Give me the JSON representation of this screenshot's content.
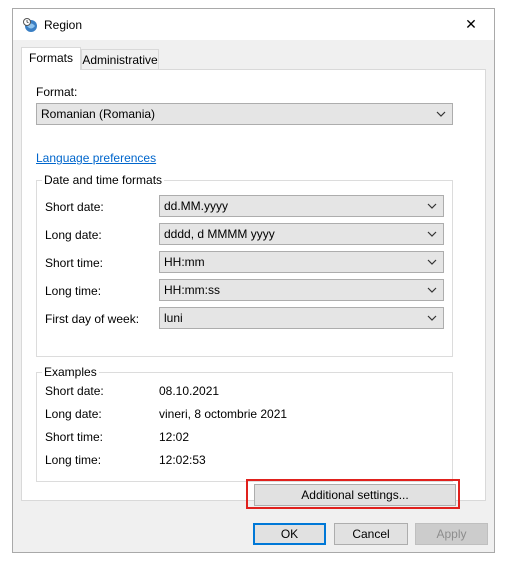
{
  "window": {
    "title": "Region",
    "close_glyph": "✕"
  },
  "tabs": [
    {
      "label": "Formats",
      "active": true
    },
    {
      "label": "Administrative",
      "active": false
    }
  ],
  "format": {
    "label": "Format:",
    "value": "Romanian (Romania)"
  },
  "language_link": "Language preferences",
  "date_time_formats": {
    "title": "Date and time formats",
    "rows": [
      {
        "label": "Short date:",
        "value": "dd.MM.yyyy"
      },
      {
        "label": "Long date:",
        "value": "dddd, d MMMM yyyy"
      },
      {
        "label": "Short time:",
        "value": "HH:mm"
      },
      {
        "label": "Long time:",
        "value": "HH:mm:ss"
      },
      {
        "label": "First day of week:",
        "value": "luni"
      }
    ]
  },
  "examples": {
    "title": "Examples",
    "rows": [
      {
        "label": "Short date:",
        "value": "08.10.2021"
      },
      {
        "label": "Long date:",
        "value": "vineri, 8 octombrie 2021"
      },
      {
        "label": "Short time:",
        "value": "12:02"
      },
      {
        "label": "Long time:",
        "value": "12:02:53"
      }
    ]
  },
  "buttons": {
    "additional": "Additional settings...",
    "ok": "OK",
    "cancel": "Cancel",
    "apply": "Apply"
  },
  "colors": {
    "link": "#0066cc",
    "highlight": "#e0211d",
    "focus": "#0078d7"
  }
}
